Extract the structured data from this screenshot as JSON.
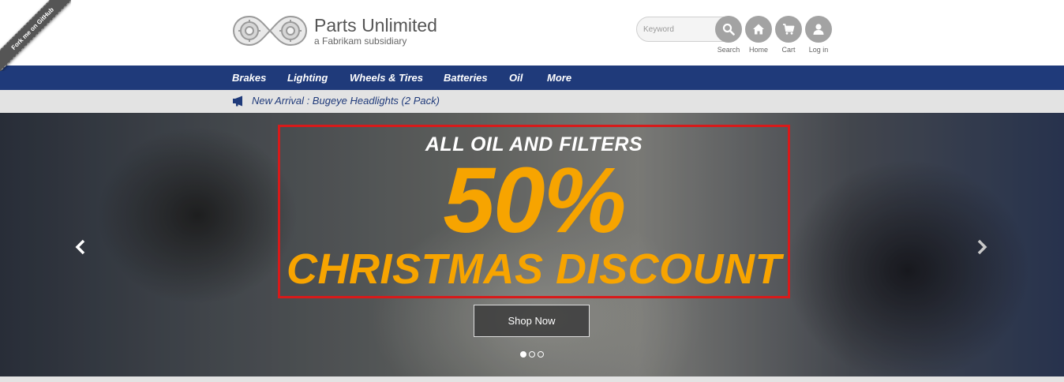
{
  "ribbon": {
    "label": "Fork me on GitHub"
  },
  "header": {
    "brand_name": "Parts Unlimited",
    "brand_sub": "a Fabrikam subsidiary",
    "logo_icon": "gears-logo-icon",
    "search_placeholder": "Keyword",
    "buttons": [
      {
        "label": "Search",
        "icon": "search-icon"
      },
      {
        "label": "Home",
        "icon": "home-icon"
      },
      {
        "label": "Cart",
        "icon": "cart-icon"
      },
      {
        "label": "Log in",
        "icon": "user-icon"
      }
    ]
  },
  "nav": {
    "items": [
      {
        "label": "Brakes"
      },
      {
        "label": "Lighting"
      },
      {
        "label": "Wheels & Tires"
      },
      {
        "label": "Batteries"
      },
      {
        "label": "Oil"
      },
      {
        "label": "More"
      }
    ]
  },
  "announcement": {
    "icon": "megaphone-icon",
    "text": "New Arrival : Bugeye Headlights (2 Pack)"
  },
  "hero": {
    "top_line": "ALL OIL AND FILTERS",
    "percent": "50%",
    "bottom_line": "CHRISTMAS DISCOUNT",
    "cta_label": "Shop Now",
    "slide_count": 3,
    "active_slide": 1,
    "prev_icon": "chevron-left-icon",
    "next_icon": "chevron-right-icon"
  },
  "colors": {
    "nav_bg": "#1f3a7a",
    "promo_accent": "#f7a400",
    "promo_border": "#d81a1a",
    "header_button": "#a3a3a3"
  }
}
